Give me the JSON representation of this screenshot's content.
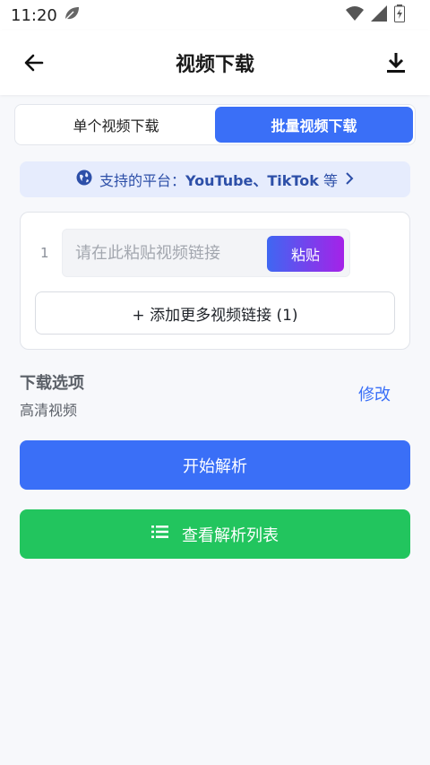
{
  "status_bar": {
    "time": "11:20"
  },
  "app_bar": {
    "title": "视频下载"
  },
  "segment": {
    "single_label": "单个视频下载",
    "batch_label": "批量视频下载",
    "active": "batch"
  },
  "platform_banner": {
    "prefix": "支持的平台：",
    "platforms": "YouTube、TikTok",
    "suffix": "等"
  },
  "link_card": {
    "rows": [
      {
        "index": "1",
        "placeholder": "请在此粘贴视频链接",
        "value": ""
      }
    ],
    "paste_label": "粘贴",
    "add_more_label": "+ 添加更多视频链接 (1)"
  },
  "download_options": {
    "title": "下载选项",
    "value": "高清视频",
    "edit_label": "修改"
  },
  "actions": {
    "parse_label": "开始解析",
    "list_label": "查看解析列表"
  },
  "colors": {
    "primary": "#3a6ff7",
    "success": "#22c55e",
    "banner_bg": "#e6ecfd"
  }
}
